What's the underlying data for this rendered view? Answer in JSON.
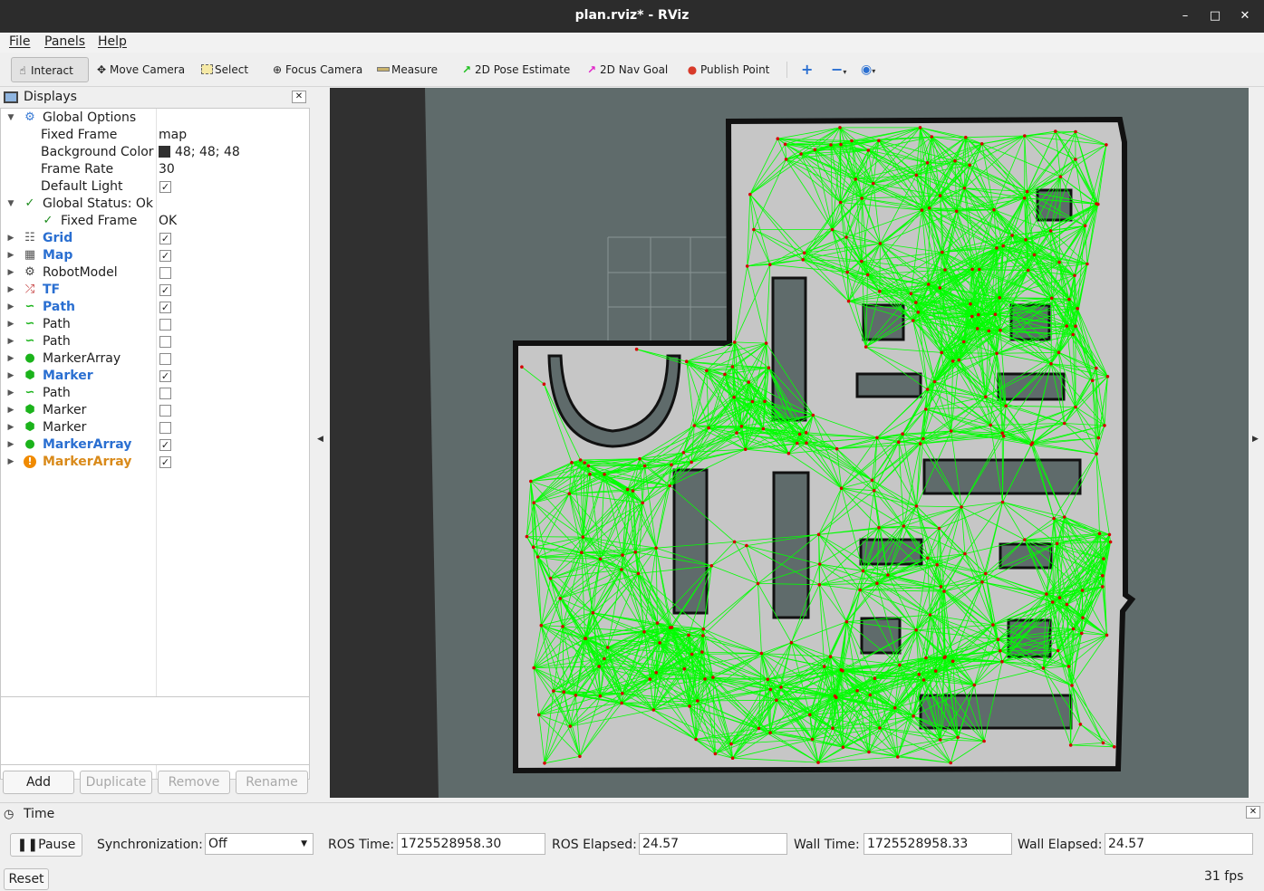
{
  "window": {
    "title": "plan.rviz* - RViz"
  },
  "menu": [
    "File",
    "Panels",
    "Help"
  ],
  "toolbar": {
    "tools": [
      {
        "label": "Interact",
        "icon": "hand-icon"
      },
      {
        "label": "Move Camera",
        "icon": "move-camera-icon"
      },
      {
        "label": "Select",
        "icon": "select-icon"
      },
      {
        "label": "Focus Camera",
        "icon": "focus-camera-icon"
      },
      {
        "label": "Measure",
        "icon": "ruler-icon"
      },
      {
        "label": "2D Pose Estimate",
        "icon": "green-arrow-icon"
      },
      {
        "label": "2D Nav Goal",
        "icon": "magenta-arrow-icon"
      },
      {
        "label": "Publish Point",
        "icon": "pin-icon"
      }
    ],
    "active_tool": "Interact"
  },
  "displays": {
    "title": "Displays",
    "global_options": {
      "label": "Global Options",
      "fixed_frame_label": "Fixed Frame",
      "fixed_frame": "map",
      "background_color_label": "Background Color",
      "background_color": "48; 48; 48",
      "background_color_hex": "#303030",
      "frame_rate_label": "Frame Rate",
      "frame_rate": "30",
      "default_light_label": "Default Light",
      "default_light": true
    },
    "global_status": {
      "label": "Global Status: Ok",
      "fixed_frame_label": "Fixed Frame",
      "fixed_frame_value": "OK"
    },
    "items": [
      {
        "name": "Grid",
        "icon": "grid-icon",
        "checked": true,
        "style": "blue"
      },
      {
        "name": "Map",
        "icon": "map-icon",
        "checked": true,
        "style": "blue"
      },
      {
        "name": "RobotModel",
        "icon": "robot-model-icon",
        "checked": false,
        "style": "normal"
      },
      {
        "name": "TF",
        "icon": "tf-icon",
        "checked": true,
        "style": "blue"
      },
      {
        "name": "Path",
        "icon": "path-icon",
        "checked": true,
        "style": "blue"
      },
      {
        "name": "Path",
        "icon": "path-icon",
        "checked": false,
        "style": "normal"
      },
      {
        "name": "Path",
        "icon": "path-icon",
        "checked": false,
        "style": "normal"
      },
      {
        "name": "MarkerArray",
        "icon": "marker-array-icon",
        "checked": false,
        "style": "normal"
      },
      {
        "name": "Marker",
        "icon": "marker-icon",
        "checked": true,
        "style": "blue"
      },
      {
        "name": "Path",
        "icon": "path-icon",
        "checked": false,
        "style": "normal"
      },
      {
        "name": "Marker",
        "icon": "marker-icon",
        "checked": false,
        "style": "normal"
      },
      {
        "name": "Marker",
        "icon": "marker-icon",
        "checked": false,
        "style": "normal"
      },
      {
        "name": "MarkerArray",
        "icon": "marker-array-icon",
        "checked": true,
        "style": "blue"
      },
      {
        "name": "MarkerArray",
        "icon": "warning-icon",
        "checked": true,
        "style": "orange"
      }
    ],
    "buttons": {
      "add": "Add",
      "duplicate": "Duplicate",
      "remove": "Remove",
      "rename": "Rename"
    }
  },
  "time_panel": {
    "title": "Time",
    "pause_label": "Pause",
    "sync_label": "Synchronization:",
    "sync_value": "Off",
    "ros_time_label": "ROS Time:",
    "ros_time": "1725528958.30",
    "ros_elapsed_label": "ROS Elapsed:",
    "ros_elapsed": "24.57",
    "wall_time_label": "Wall Time:",
    "wall_time": "1725528958.33",
    "wall_elapsed_label": "Wall Elapsed:",
    "wall_elapsed": "24.57",
    "reset_label": "Reset",
    "fps": "31 fps"
  },
  "viewport": {
    "background": "#303030",
    "unknown_space_color": "#5f6b6b",
    "free_space_color": "#c8c8c8",
    "edge_color": "#00ff00",
    "node_color": "#d40000"
  }
}
